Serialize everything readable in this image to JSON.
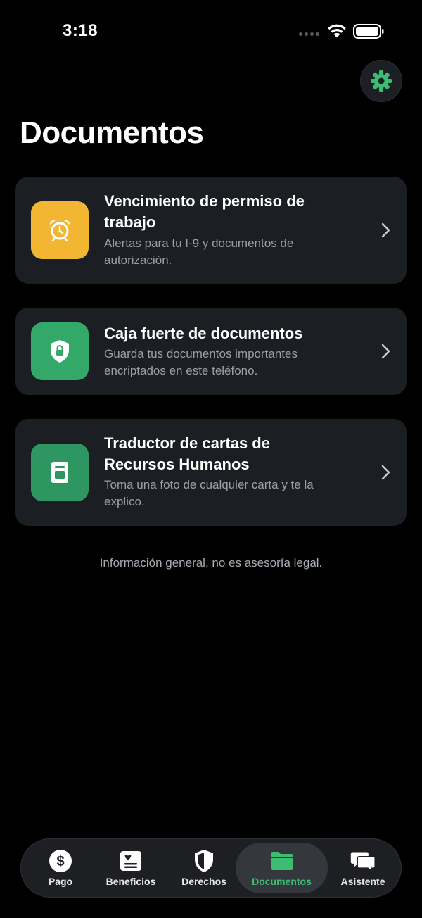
{
  "status_bar": {
    "time": "3:18"
  },
  "header": {
    "title": "Documentos",
    "settings_icon": "gear-icon"
  },
  "cards": [
    {
      "title": "Vencimiento de permiso de trabajo",
      "description": "Alertas para tu I-9 y documentos de autorización.",
      "icon": "alarm-clock-icon",
      "icon_color": "#f2b632"
    },
    {
      "title": "Caja fuerte de documentos",
      "description": "Guarda tus documentos importantes encriptados en este teléfono.",
      "icon": "shield-lock-icon",
      "icon_color": "#33a868"
    },
    {
      "title": "Traductor de cartas de Recursos Humanos",
      "description": "Toma una foto de cualquier carta y te la explico.",
      "icon": "document-icon",
      "icon_color": "#2e9660"
    }
  ],
  "disclaimer": "Información general, no es asesoría legal.",
  "tab_bar": {
    "active": "Documentos",
    "accent_color": "#3dbd73",
    "tabs": [
      {
        "label": "Pago",
        "icon": "dollar-circle-icon"
      },
      {
        "label": "Beneficios",
        "icon": "id-card-icon"
      },
      {
        "label": "Derechos",
        "icon": "shield-icon"
      },
      {
        "label": "Documentos",
        "icon": "folder-icon"
      },
      {
        "label": "Asistente",
        "icon": "chat-bubbles-icon"
      }
    ]
  }
}
